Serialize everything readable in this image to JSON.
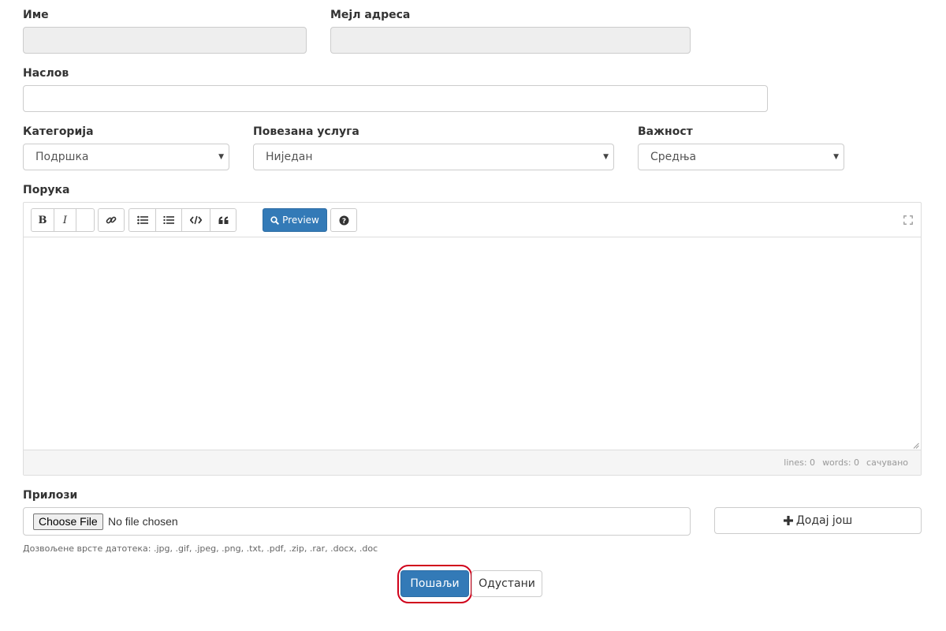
{
  "form": {
    "name_label": "Име",
    "email_label": "Мејл адреса",
    "subject_label": "Наслов",
    "category_label": "Категорија",
    "category_value": "Подршка",
    "service_label": "Повезана услуга",
    "service_value": "Ниједан",
    "priority_label": "Важност",
    "priority_value": "Средња",
    "message_label": "Порука"
  },
  "editor": {
    "preview_label": "Preview",
    "status_lines": "lines: 0",
    "status_words": "words: 0",
    "status_saved": "сачувано",
    "icons": [
      "bold-icon",
      "italic-icon",
      "link-icon",
      "unordered-list-icon",
      "ordered-list-icon",
      "code-icon",
      "quote-icon",
      "search-icon",
      "help-icon",
      "fullscreen-icon"
    ]
  },
  "attachments": {
    "label": "Прилози",
    "choose_file_label": "Choose File",
    "no_file_text": "No file chosen",
    "add_more_label": "Додај још",
    "allowed_text": "Дозвољене врсте датотека: .jpg, .gif, .jpeg, .png, .txt, .pdf, .zip, .rar, .docx, .doc"
  },
  "actions": {
    "submit_label": "Пошаљи",
    "cancel_label": "Одустани",
    "highlight_color": "#d0021b",
    "primary_color": "#337ab7"
  }
}
